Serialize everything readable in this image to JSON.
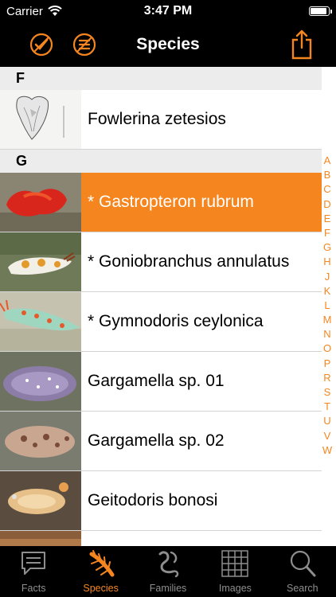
{
  "status_bar": {
    "carrier": "Carrier",
    "time": "3:47 PM",
    "battery_level": 0.95
  },
  "nav": {
    "title": "Species"
  },
  "sections": [
    {
      "letter": "F",
      "items": [
        {
          "label": "Fowlerina zetesios",
          "selected": false,
          "thumb": "fowlerina-drawing"
        }
      ]
    },
    {
      "letter": "G",
      "items": [
        {
          "label": "* Gastropteron rubrum",
          "selected": true,
          "thumb": "gastropteron"
        },
        {
          "label": "* Goniobranchus annulatus",
          "selected": false,
          "thumb": "goniobranchus"
        },
        {
          "label": "* Gymnodoris ceylonica",
          "selected": false,
          "thumb": "gymnodoris"
        },
        {
          "label": "Gargamella sp. 01",
          "selected": false,
          "thumb": "gargamella1"
        },
        {
          "label": "Gargamella sp. 02",
          "selected": false,
          "thumb": "gargamella2"
        },
        {
          "label": "Geitodoris bonosi",
          "selected": false,
          "thumb": "geitodoris"
        },
        {
          "label": "",
          "selected": false,
          "thumb": "partial"
        }
      ]
    }
  ],
  "index": [
    "A",
    "B",
    "C",
    "D",
    "E",
    "F",
    "G",
    "H",
    "J",
    "K",
    "L",
    "M",
    "N",
    "O",
    "P",
    "R",
    "S",
    "T",
    "U",
    "V",
    "W"
  ],
  "tabs": [
    {
      "label": "Facts",
      "icon": "speech-bubble-icon",
      "active": false
    },
    {
      "label": "Species",
      "icon": "nudibranch-icon",
      "active": true
    },
    {
      "label": "Families",
      "icon": "family-tree-icon",
      "active": false
    },
    {
      "label": "Images",
      "icon": "grid-icon",
      "active": false
    },
    {
      "label": "Search",
      "icon": "magnifier-icon",
      "active": false
    }
  ],
  "colors": {
    "accent": "#f5861f",
    "bar": "#000000",
    "section": "#ececec",
    "inactive_tab": "#8e8e8e"
  }
}
